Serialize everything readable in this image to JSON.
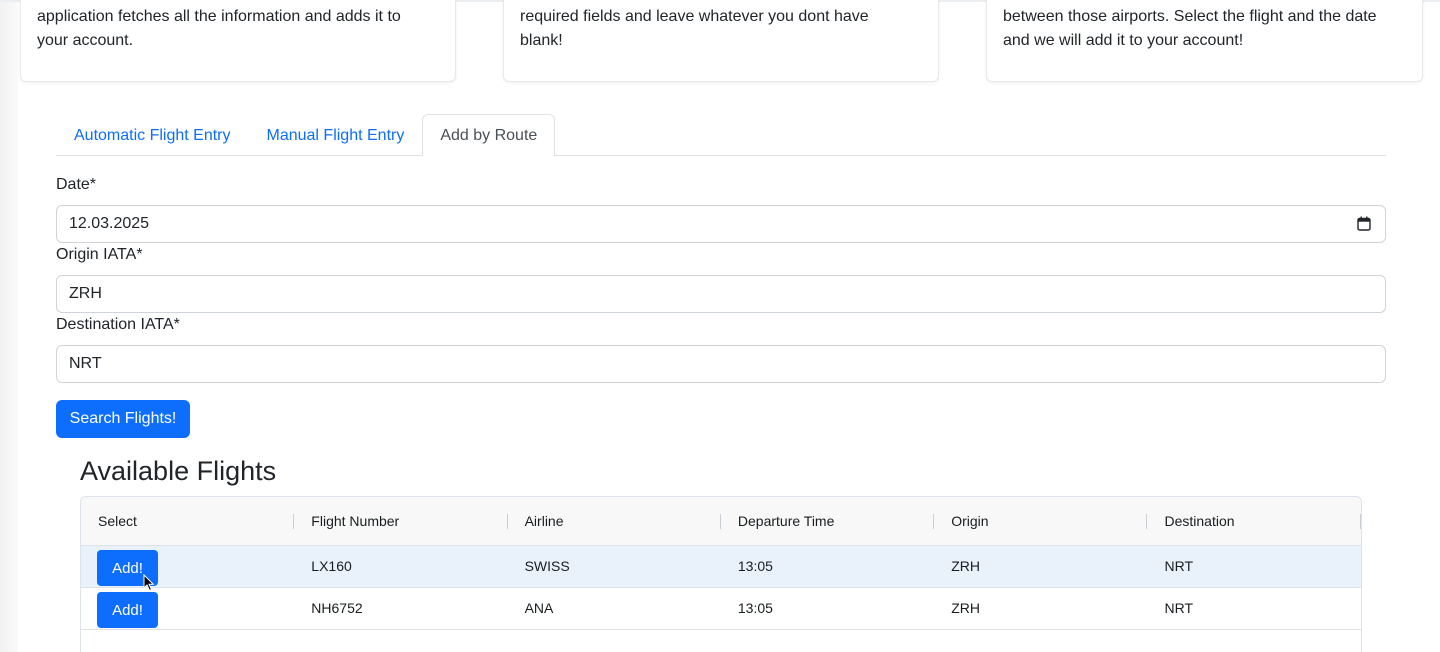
{
  "cards": [
    {
      "text": "application fetches all the information and adds it to\nyour account."
    },
    {
      "text": "required fields and leave whatever you dont have\nblank!"
    },
    {
      "text": "between those airports. Select the flight and the date\nand we will add it to your account!"
    }
  ],
  "tabs": [
    {
      "label": "Automatic Flight Entry"
    },
    {
      "label": "Manual Flight Entry"
    },
    {
      "label": "Add by Route"
    }
  ],
  "form": {
    "date_label": "Date*",
    "date_value": "12.03.2025",
    "origin_label": "Origin IATA*",
    "origin_value": "ZRH",
    "destination_label": "Destination IATA*",
    "destination_value": "NRT",
    "search_label": "Search Flights!"
  },
  "flights": {
    "title": "Available Flights",
    "columns": [
      "Select",
      "Flight Number",
      "Airline",
      "Departure Time",
      "Origin",
      "Destination"
    ],
    "add_label": "Add!",
    "rows": [
      {
        "flight_number": "LX160",
        "airline": "SWISS",
        "departure": "13:05",
        "origin": "ZRH",
        "destination": "NRT"
      },
      {
        "flight_number": "NH6752",
        "airline": "ANA",
        "departure": "13:05",
        "origin": "ZRH",
        "destination": "NRT"
      }
    ]
  },
  "colors": {
    "primary": "#0d6efd",
    "selected_row": "#e9f1fb"
  },
  "icons": {
    "date_picker": "calendar-icon",
    "pointer": "mouse-cursor-icon"
  }
}
